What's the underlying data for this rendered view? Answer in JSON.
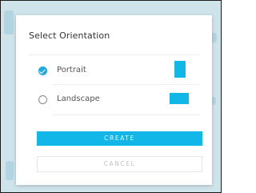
{
  "dialog": {
    "title": "Select Orientation",
    "options": [
      {
        "label": "Portrait",
        "selected": true,
        "icon": "portrait-page-icon"
      },
      {
        "label": "Landscape",
        "selected": false,
        "icon": "landscape-page-icon"
      }
    ],
    "create_label": "CREATE",
    "cancel_label": "CANCEL"
  },
  "colors": {
    "accent": "#12b7e8",
    "background": "#cfe3ea"
  }
}
